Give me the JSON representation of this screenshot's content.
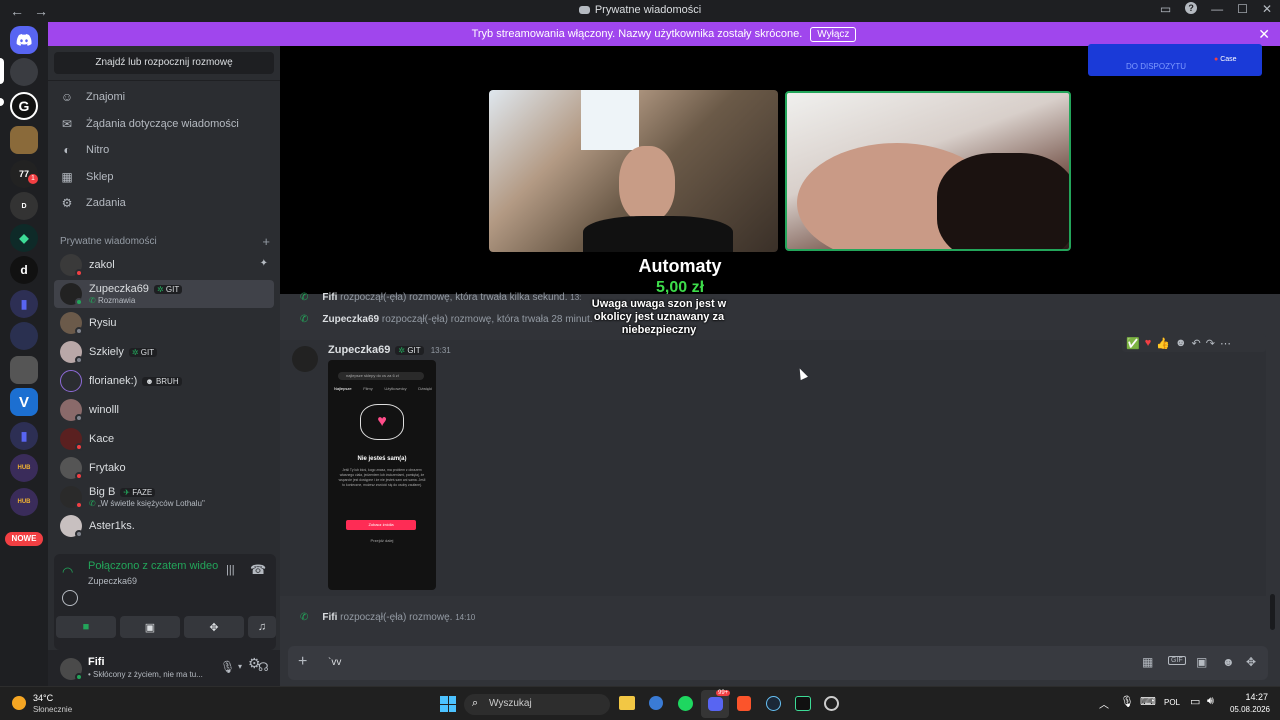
{
  "window": {
    "title": "Prywatne wiadomości",
    "nav_back": "←",
    "nav_forward": "→"
  },
  "banner": {
    "text": "Tryb streamowania włączony. Nazwy użytkownika zostały skrócone.",
    "button": "Wyłącz",
    "close": "✕"
  },
  "guilds": {
    "new_badge": "NOWE",
    "items": [
      "Discord",
      "G",
      "d",
      "V"
    ]
  },
  "sidebar": {
    "search_placeholder": "Znajdź lub rozpocznij rozmowę",
    "nav": [
      {
        "label": "Znajomi",
        "icon": "friends-icon"
      },
      {
        "label": "Żądania dotyczące wiadomości",
        "icon": "mail-icon"
      },
      {
        "label": "Nitro",
        "icon": "nitro-icon"
      },
      {
        "label": "Sklep",
        "icon": "shop-icon"
      },
      {
        "label": "Zadania",
        "icon": "quests-icon"
      }
    ],
    "dm_header": "Prywatne wiadomości",
    "dms": [
      {
        "name": "zakol",
        "status": "dnd",
        "pinned": true
      },
      {
        "name": "Zupeczka69",
        "tag": "GIT",
        "sub": "Rozmawia",
        "status": "online",
        "active": true
      },
      {
        "name": "Rysiu",
        "status": "idle"
      },
      {
        "name": "Szkiely",
        "tag": "GIT",
        "status": "idle"
      },
      {
        "name": "florianek:)",
        "tag": "BRUH",
        "status": "none"
      },
      {
        "name": "winolll",
        "status": "idle"
      },
      {
        "name": "Kace",
        "status": "dnd"
      },
      {
        "name": "Frytako",
        "status": "dnd"
      },
      {
        "name": "Big B",
        "tag": "FAZE",
        "sub": "„W świetle księżyców Lothalu\"",
        "status": "dnd"
      },
      {
        "name": "Aster1ks.",
        "status": "idle"
      }
    ]
  },
  "voice": {
    "status": "Połączono z czatem wideo",
    "channel": "Zupeczka69"
  },
  "user": {
    "name": "Fifi",
    "status": "• Skłócony z życiem, nie ma tu..."
  },
  "overlay": {
    "title": "Automaty",
    "amount": "5,00 zł",
    "message": "Uwaga uwaga szon jest w okolicy jest uznawany za niebezpieczny",
    "corner_text": "DO DISPOZYTU",
    "corner_brand": "Case"
  },
  "chat": {
    "calls": [
      {
        "who": "Fifi",
        "text": "rozpoczął(-ęła) rozmowę, która trwała kilka sekund.",
        "time": "13:"
      },
      {
        "who": "Zupeczka69",
        "text": "rozpoczął(-ęła) rozmowę, która trwała 28 minut."
      }
    ],
    "message": {
      "author": "Zupeczka69",
      "tag": "GIT",
      "time": "13:31",
      "image": {
        "search": "najlepsze sklepy do cs za 6 zł",
        "tabs": [
          "Najlepsze",
          "Filmy",
          "Użytkownicy",
          "Dźwięki"
        ],
        "heading": "Nie jesteś sam(a)",
        "body": "Jeśli Ty lub ktoś, kogo znasz, ma problem z obrazem własnego ciała, jedzeniem lub ćwiczeniami, pamiętaj, że wsparcie jest dostępne i że nie jesteś sam ani sama. Jeśli to konieczne, możesz zwrócić się do osoby zaufanej.",
        "button": "Zobacz źródła",
        "link": "Przejdź dalej"
      }
    },
    "last_call": {
      "who": "Fifi",
      "text": "rozpoczął(-ęła) rozmowę.",
      "time": "14:10"
    },
    "input_value": "`vv"
  },
  "taskbar": {
    "weather_temp": "34°C",
    "weather_desc": "Słonecznie",
    "search": "Wyszukaj",
    "lang": "POL",
    "time": "14:27",
    "date": "05.08.2026",
    "badge": "99+"
  },
  "colors": {
    "banner": "#a046ed",
    "accent_green": "#23a55a",
    "money_green": "#3ddc4a",
    "blurple": "#5865f2",
    "dnd": "#f23f43",
    "idle": "#f0b232"
  }
}
